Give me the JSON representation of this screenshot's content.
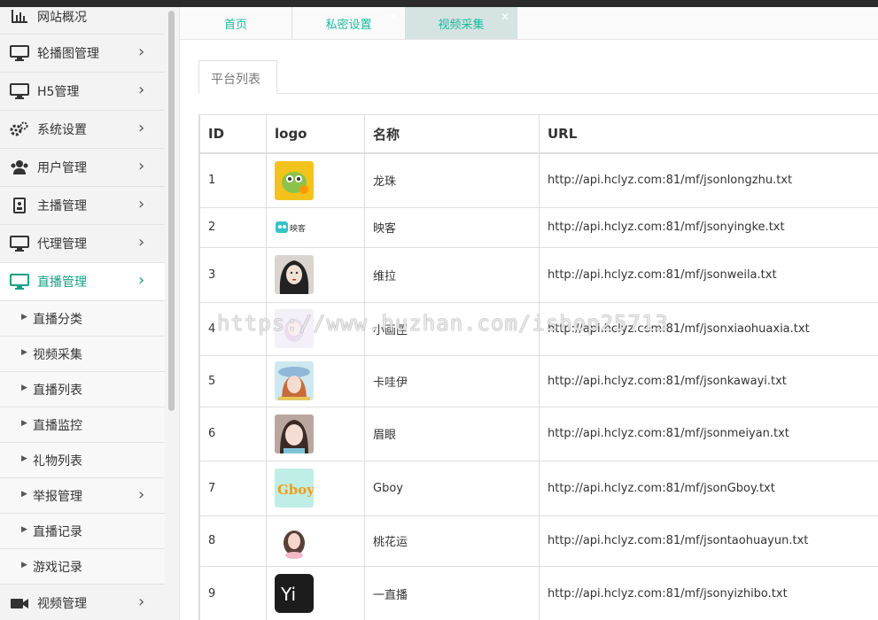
{
  "sidebar": {
    "top_items": [
      {
        "label": "网站概况",
        "icon": "bar-chart-icon",
        "has_arrow": false
      },
      {
        "label": "轮播图管理",
        "icon": "monitor-icon",
        "has_arrow": true
      },
      {
        "label": "H5管理",
        "icon": "monitor-icon",
        "has_arrow": true
      },
      {
        "label": "系统设置",
        "icon": "gears-icon",
        "has_arrow": true
      },
      {
        "label": "用户管理",
        "icon": "users-icon",
        "has_arrow": true
      },
      {
        "label": "主播管理",
        "icon": "id-card-icon",
        "has_arrow": true
      },
      {
        "label": "代理管理",
        "icon": "monitor-icon",
        "has_arrow": true
      },
      {
        "label": "直播管理",
        "icon": "monitor-icon",
        "has_arrow": true,
        "active": true
      }
    ],
    "sub_items": [
      {
        "label": "直播分类",
        "has_arrow": false
      },
      {
        "label": "视频采集",
        "has_arrow": false
      },
      {
        "label": "直播列表",
        "has_arrow": false
      },
      {
        "label": "直播监控",
        "has_arrow": false
      },
      {
        "label": "礼物列表",
        "has_arrow": false
      },
      {
        "label": "举报管理",
        "has_arrow": true
      },
      {
        "label": "直播记录",
        "has_arrow": false
      },
      {
        "label": "游戏记录",
        "has_arrow": false
      }
    ],
    "bottom_item": {
      "label": "视频管理",
      "icon": "video-camera-icon",
      "has_arrow": true
    }
  },
  "tabs": [
    {
      "label": "首页",
      "closable": false
    },
    {
      "label": "私密设置",
      "closable": true
    },
    {
      "label": "视频采集",
      "closable": true,
      "active": true
    }
  ],
  "panel_tab": "平台列表",
  "table": {
    "columns": [
      "ID",
      "logo",
      "名称",
      "URL"
    ],
    "rows": [
      {
        "id": "1",
        "logo": "dragon",
        "name": "龙珠",
        "url": "http://api.hclyz.com:81/mf/jsonlongzhu.txt"
      },
      {
        "id": "2",
        "logo": "yingke",
        "name": "映客",
        "url": "http://api.hclyz.com:81/mf/jsonyingke.txt"
      },
      {
        "id": "3",
        "logo": "portrait-dark",
        "name": "维拉",
        "url": "http://api.hclyz.com:81/mf/jsonweila.txt"
      },
      {
        "id": "4",
        "logo": "portrait-light",
        "name": "小画匣",
        "url": "http://api.hclyz.com:81/mf/jsonxiaohuaxia.txt"
      },
      {
        "id": "5",
        "logo": "portrait-hat",
        "name": "卡哇伊",
        "url": "http://api.hclyz.com:81/mf/jsonkawayi.txt"
      },
      {
        "id": "6",
        "logo": "portrait-girl",
        "name": "眉眼",
        "url": "http://api.hclyz.com:81/mf/jsonmeiyan.txt"
      },
      {
        "id": "7",
        "logo": "gboy",
        "name": "Gboy",
        "url": "http://api.hclyz.com:81/mf/jsonGboy.txt"
      },
      {
        "id": "8",
        "logo": "portrait-small",
        "name": "桃花运",
        "url": "http://api.hclyz.com:81/mf/jsontaohuayun.txt"
      },
      {
        "id": "9",
        "logo": "yi-black",
        "name": "一直播",
        "url": "http://api.hclyz.com:81/mf/jsonyizhibo.txt"
      }
    ]
  },
  "logo_texts": {
    "yingke": "映客",
    "gboy": "Gboy",
    "yi": "Yi"
  },
  "watermark": "https://www.huzhan.com/ishop25713",
  "colors": {
    "accent": "#1abc9c",
    "active_text": "#16a085",
    "active_tab": "#d5e3e3"
  }
}
